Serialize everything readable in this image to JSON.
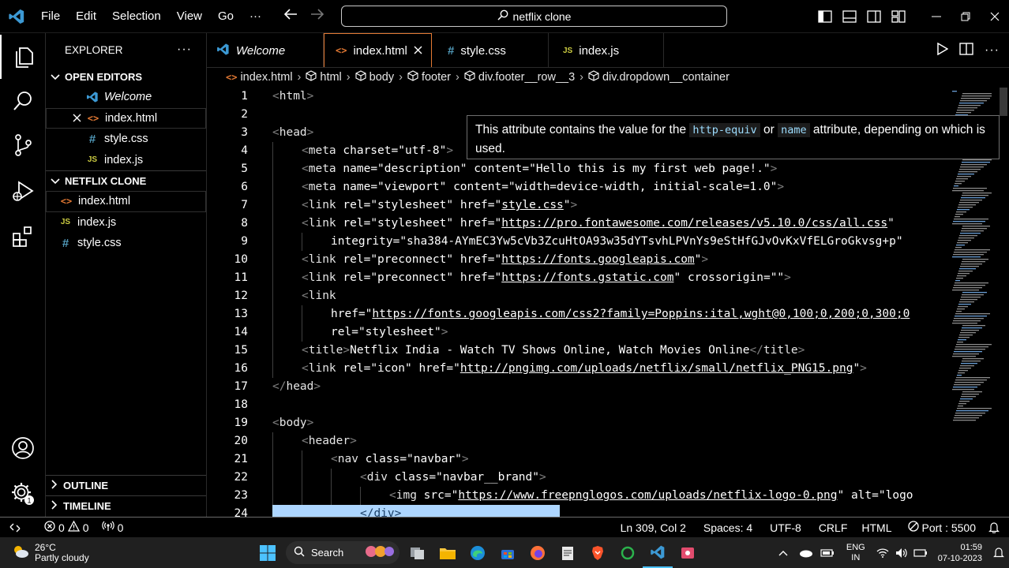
{
  "titlebar": {
    "menu": [
      "File",
      "Edit",
      "Selection",
      "View",
      "Go",
      "···"
    ],
    "search": "netflix clone"
  },
  "sidebar": {
    "title": "EXPLORER",
    "open_editors_label": "OPEN EDITORS",
    "open_editors": [
      {
        "name": "Welcome",
        "icon": "vscode-icon"
      },
      {
        "name": "index.html",
        "icon": "html-icon"
      },
      {
        "name": "style.css",
        "icon": "css-icon"
      },
      {
        "name": "index.js",
        "icon": "js-icon"
      }
    ],
    "project_label": "NETFLIX CLONE",
    "files": [
      {
        "name": "index.html",
        "icon": "html-icon"
      },
      {
        "name": "index.js",
        "icon": "js-icon"
      },
      {
        "name": "style.css",
        "icon": "css-icon"
      }
    ],
    "outline_label": "OUTLINE",
    "timeline_label": "TIMELINE",
    "icon_glyphs": {
      "html": "<>",
      "css": "#",
      "js": "JS"
    }
  },
  "tabs": [
    {
      "label": "Welcome"
    },
    {
      "label": "index.html"
    },
    {
      "label": "style.css"
    },
    {
      "label": "index.js"
    }
  ],
  "breadcrumb": [
    "index.html",
    "html",
    "body",
    "footer",
    "div.footer__row__3",
    "div.dropdown__container"
  ],
  "hover": {
    "text1": "This attribute contains the value for the ",
    "code1": "http-equiv",
    "text2": " or ",
    "code2": "name",
    "text3": " attribute, depending on which is used."
  },
  "code_lines": [
    {
      "n": "1",
      "indent": 0,
      "tokens": [
        [
          "b",
          "<"
        ],
        [
          "t",
          "html"
        ],
        [
          "b",
          ">"
        ]
      ]
    },
    {
      "n": "2",
      "indent": 0,
      "tokens": []
    },
    {
      "n": "3",
      "indent": 0,
      "tokens": [
        [
          "b",
          "<"
        ],
        [
          "t",
          "head"
        ],
        [
          "b",
          ">"
        ]
      ]
    },
    {
      "n": "4",
      "indent": 1,
      "tokens": [
        [
          "b",
          "<"
        ],
        [
          "t",
          "meta "
        ],
        [
          "a",
          "charset"
        ],
        [
          "a",
          "="
        ],
        [
          "v",
          "\"utf-8\""
        ],
        [
          "b",
          ">"
        ]
      ]
    },
    {
      "n": "5",
      "indent": 1,
      "tokens": [
        [
          "b",
          "<"
        ],
        [
          "t",
          "meta "
        ],
        [
          "a",
          "name"
        ],
        [
          "a",
          "="
        ],
        [
          "v",
          "\"description\" "
        ],
        [
          "a",
          "content"
        ],
        [
          "a",
          "="
        ],
        [
          "v",
          "\"Hello this is my first web page!.\""
        ],
        [
          "b",
          ">"
        ]
      ]
    },
    {
      "n": "6",
      "indent": 1,
      "tokens": [
        [
          "b",
          "<"
        ],
        [
          "t",
          "meta "
        ],
        [
          "a",
          "name"
        ],
        [
          "a",
          "="
        ],
        [
          "v",
          "\"viewport\" "
        ],
        [
          "a",
          "content"
        ],
        [
          "a",
          "="
        ],
        [
          "v",
          "\"width=device-width, initial-scale=1.0\""
        ],
        [
          "b",
          ">"
        ]
      ]
    },
    {
      "n": "7",
      "indent": 1,
      "tokens": [
        [
          "b",
          "<"
        ],
        [
          "t",
          "link "
        ],
        [
          "a",
          "rel"
        ],
        [
          "a",
          "="
        ],
        [
          "v",
          "\"stylesheet\" "
        ],
        [
          "a",
          "href"
        ],
        [
          "a",
          "="
        ],
        [
          "v",
          "\""
        ],
        [
          "u",
          "style.css"
        ],
        [
          "v",
          "\""
        ],
        [
          "b",
          ">"
        ]
      ]
    },
    {
      "n": "8",
      "indent": 1,
      "tokens": [
        [
          "b",
          "<"
        ],
        [
          "t",
          "link "
        ],
        [
          "a",
          "rel"
        ],
        [
          "a",
          "="
        ],
        [
          "v",
          "\"stylesheet\" "
        ],
        [
          "a",
          "href"
        ],
        [
          "a",
          "="
        ],
        [
          "v",
          "\""
        ],
        [
          "u",
          "https://pro.fontawesome.com/releases/v5.10.0/css/all.css"
        ],
        [
          "v",
          "\""
        ]
      ]
    },
    {
      "n": "9",
      "indent": 2,
      "tokens": [
        [
          "a",
          "integrity"
        ],
        [
          "a",
          "="
        ],
        [
          "v",
          "\"sha384-AYmEC3Yw5cVb3ZcuHtOA93w35dYTsvhLPVnYs9eStHfGJvOvKxVfELGroGkvsg+p\""
        ]
      ]
    },
    {
      "n": "10",
      "indent": 1,
      "tokens": [
        [
          "b",
          "<"
        ],
        [
          "t",
          "link "
        ],
        [
          "a",
          "rel"
        ],
        [
          "a",
          "="
        ],
        [
          "v",
          "\"preconnect\" "
        ],
        [
          "a",
          "href"
        ],
        [
          "a",
          "="
        ],
        [
          "v",
          "\""
        ],
        [
          "u",
          "https://fonts.googleapis.com"
        ],
        [
          "v",
          "\""
        ],
        [
          "b",
          ">"
        ]
      ]
    },
    {
      "n": "11",
      "indent": 1,
      "tokens": [
        [
          "b",
          "<"
        ],
        [
          "t",
          "link "
        ],
        [
          "a",
          "rel"
        ],
        [
          "a",
          "="
        ],
        [
          "v",
          "\"preconnect\" "
        ],
        [
          "a",
          "href"
        ],
        [
          "a",
          "="
        ],
        [
          "v",
          "\""
        ],
        [
          "u",
          "https://fonts.gstatic.com"
        ],
        [
          "v",
          "\" "
        ],
        [
          "a",
          "crossorigin"
        ],
        [
          "a",
          "="
        ],
        [
          "v",
          "\"\""
        ],
        [
          "b",
          ">"
        ]
      ]
    },
    {
      "n": "12",
      "indent": 1,
      "tokens": [
        [
          "b",
          "<"
        ],
        [
          "t",
          "link"
        ]
      ]
    },
    {
      "n": "13",
      "indent": 2,
      "tokens": [
        [
          "a",
          "href"
        ],
        [
          "a",
          "="
        ],
        [
          "v",
          "\""
        ],
        [
          "u",
          "https://fonts.googleapis.com/css2?family=Poppins:ital,wght@0,100;0,200;0,300;0"
        ]
      ]
    },
    {
      "n": "14",
      "indent": 2,
      "tokens": [
        [
          "a",
          "rel"
        ],
        [
          "a",
          "="
        ],
        [
          "v",
          "\"stylesheet\""
        ],
        [
          "b",
          ">"
        ]
      ]
    },
    {
      "n": "15",
      "indent": 1,
      "tokens": [
        [
          "b",
          "<"
        ],
        [
          "t",
          "title"
        ],
        [
          "b",
          ">"
        ],
        [
          "a",
          "Netflix India - Watch TV Shows Online, Watch Movies Online"
        ],
        [
          "b",
          "</"
        ],
        [
          "t",
          "title"
        ],
        [
          "b",
          ">"
        ]
      ]
    },
    {
      "n": "16",
      "indent": 1,
      "tokens": [
        [
          "b",
          "<"
        ],
        [
          "t",
          "link "
        ],
        [
          "a",
          "rel"
        ],
        [
          "a",
          "="
        ],
        [
          "v",
          "\"icon\" "
        ],
        [
          "a",
          "href"
        ],
        [
          "a",
          "="
        ],
        [
          "v",
          "\""
        ],
        [
          "u",
          "http://pngimg.com/uploads/netflix/small/netflix_PNG15.png"
        ],
        [
          "v",
          "\""
        ],
        [
          "b",
          ">"
        ]
      ]
    },
    {
      "n": "17",
      "indent": 0,
      "tokens": [
        [
          "b",
          "</"
        ],
        [
          "t",
          "head"
        ],
        [
          "b",
          ">"
        ]
      ]
    },
    {
      "n": "18",
      "indent": 0,
      "tokens": []
    },
    {
      "n": "19",
      "indent": 0,
      "tokens": [
        [
          "b",
          "<"
        ],
        [
          "t",
          "body"
        ],
        [
          "b",
          ">"
        ]
      ]
    },
    {
      "n": "20",
      "indent": 1,
      "tokens": [
        [
          "b",
          "<"
        ],
        [
          "t",
          "header"
        ],
        [
          "b",
          ">"
        ]
      ]
    },
    {
      "n": "21",
      "indent": 2,
      "tokens": [
        [
          "b",
          "<"
        ],
        [
          "t",
          "nav "
        ],
        [
          "a",
          "class"
        ],
        [
          "a",
          "="
        ],
        [
          "v",
          "\"navbar\""
        ],
        [
          "b",
          ">"
        ]
      ]
    },
    {
      "n": "22",
      "indent": 3,
      "tokens": [
        [
          "b",
          "<"
        ],
        [
          "t",
          "div "
        ],
        [
          "a",
          "class"
        ],
        [
          "a",
          "="
        ],
        [
          "v",
          "\"navbar__brand\""
        ],
        [
          "b",
          ">"
        ]
      ]
    },
    {
      "n": "23",
      "indent": 4,
      "tokens": [
        [
          "b",
          "<"
        ],
        [
          "t",
          "img "
        ],
        [
          "a",
          "src"
        ],
        [
          "a",
          "="
        ],
        [
          "v",
          "\""
        ],
        [
          "u",
          "https://www.freepnglogos.com/uploads/netflix-logo-0.png"
        ],
        [
          "v",
          "\" "
        ],
        [
          "a",
          "alt"
        ],
        [
          "a",
          "="
        ],
        [
          "v",
          "\"logo"
        ]
      ]
    },
    {
      "n": "24",
      "indent": 3,
      "tokens": [
        [
          "b",
          "</"
        ],
        [
          "t",
          "div"
        ],
        [
          "b",
          ">"
        ]
      ]
    }
  ],
  "statusbar": {
    "errors": "0",
    "warnings": "0",
    "ports_count": "0",
    "position": "Ln 309, Col 2",
    "spaces": "Spaces: 4",
    "encoding": "UTF-8",
    "eol": "CRLF",
    "language": "HTML",
    "port": "Port : 5500"
  },
  "taskbar": {
    "weather_temp": "26°C",
    "weather_desc": "Partly cloudy",
    "search": "Search",
    "lang": "ENG",
    "region": "IN",
    "time": "01:59",
    "date": "07-10-2023"
  },
  "colors": {
    "html_icon": "#e37933",
    "css_icon": "#519aba",
    "js_icon": "#cbcb41",
    "vscode_blue": "#3c99d4"
  }
}
